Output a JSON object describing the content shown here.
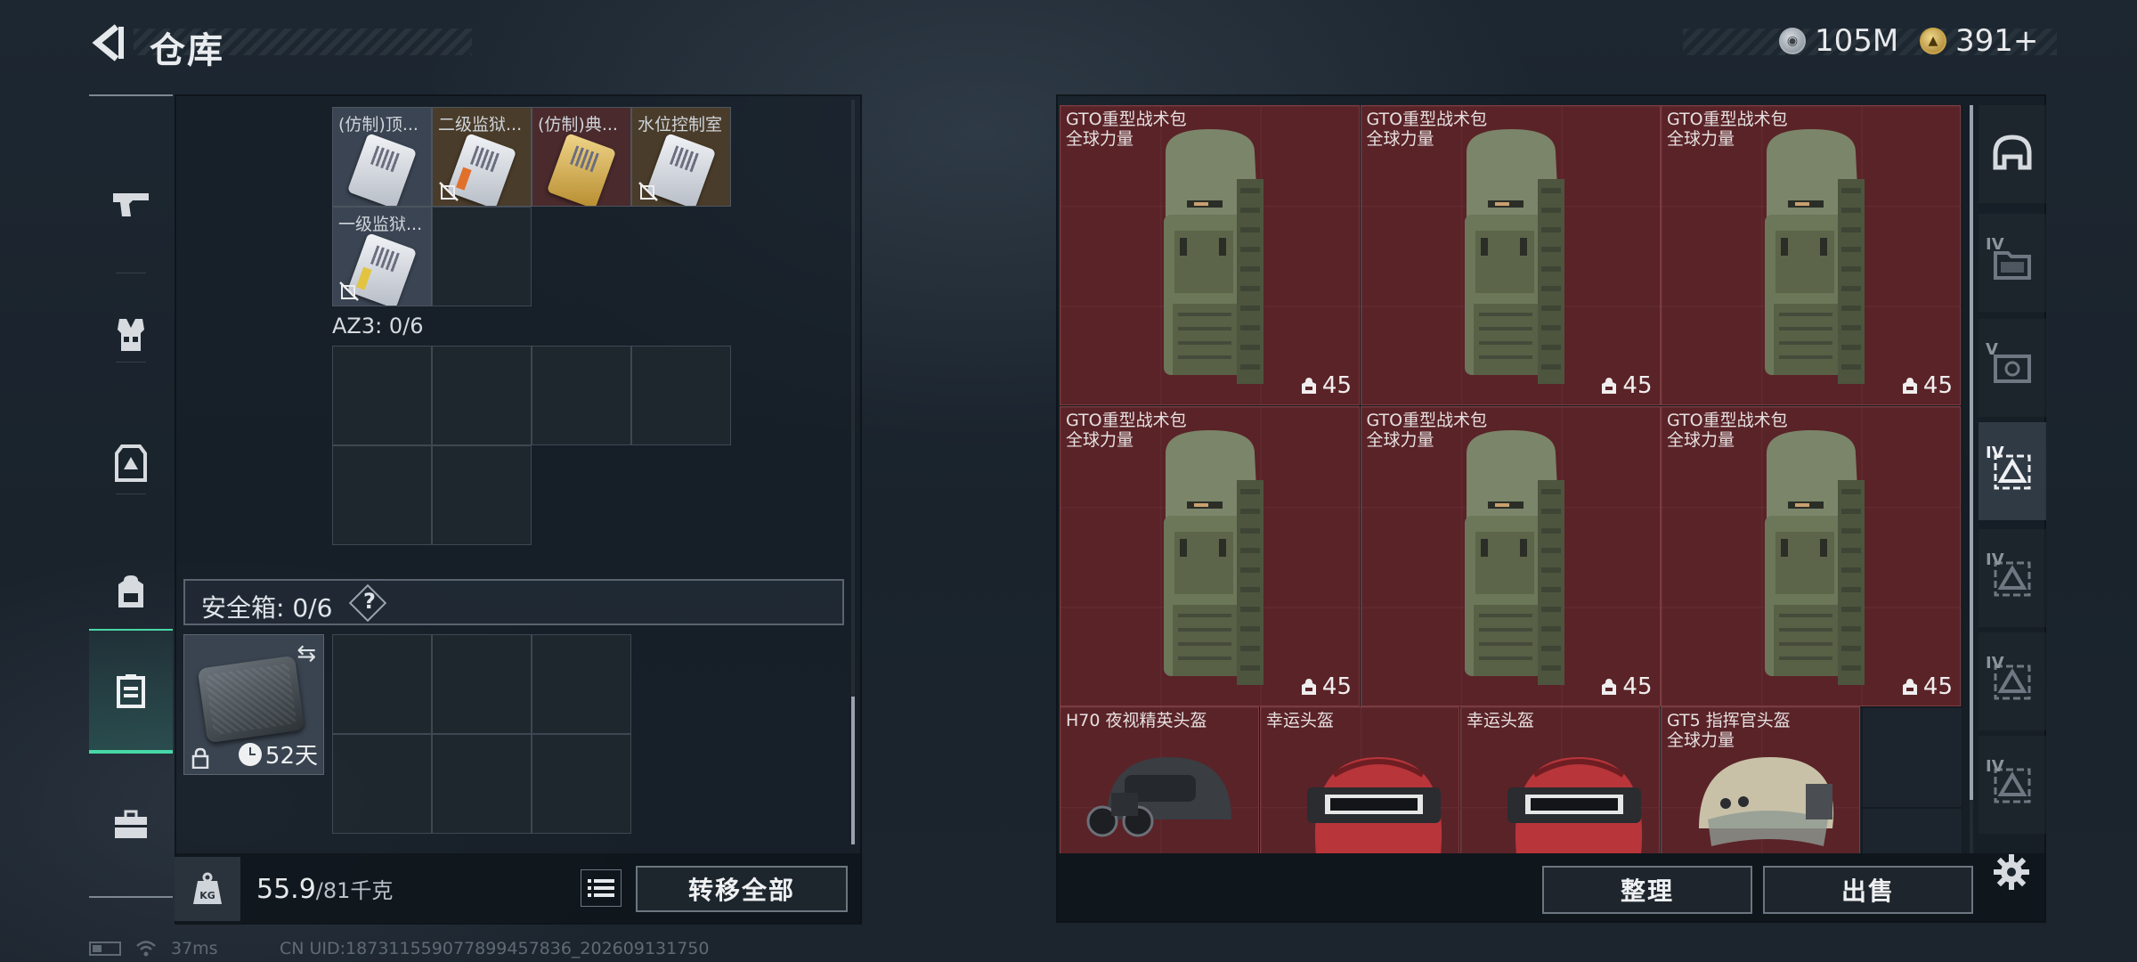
{
  "header": {
    "title": "仓库",
    "currencies": [
      {
        "icon": "silver-coin-icon",
        "value": "105M"
      },
      {
        "icon": "gold-coin-icon",
        "value": "391+"
      }
    ]
  },
  "left_nav": [
    {
      "icon": "pistol-icon"
    },
    {
      "icon": "vest-icon"
    },
    {
      "icon": "armor-icon"
    },
    {
      "icon": "backpack-icon"
    },
    {
      "icon": "safebox-icon",
      "active": true
    },
    {
      "icon": "toolbox-icon"
    }
  ],
  "keycards": [
    {
      "label": "(仿制)顶...",
      "style": "gray",
      "variant": "plain",
      "no_discard": false
    },
    {
      "label": "二级监狱...",
      "style": "gold",
      "variant": "orange",
      "no_discard": true
    },
    {
      "label": "(仿制)典...",
      "style": "red",
      "variant": "gold",
      "no_discard": false
    },
    {
      "label": "水位控制室",
      "style": "gold",
      "variant": "plain",
      "no_discard": true
    },
    {
      "label": "一级监狱...",
      "style": "gray",
      "variant": "yellow",
      "no_discard": true
    }
  ],
  "az3": {
    "label": "AZ3: 0/6"
  },
  "safebox": {
    "label": "安全箱:  0/6",
    "help": "?",
    "days": "52天"
  },
  "footer_left": {
    "weight_current": "55.9",
    "weight_max": "/81千克",
    "transfer_all": "转移全部"
  },
  "stash_items": {
    "backpacks": [
      {
        "name": "GTO重型战术包",
        "sub": "全球力量",
        "capacity": "45"
      },
      {
        "name": "GTO重型战术包",
        "sub": "全球力量",
        "capacity": "45"
      },
      {
        "name": "GTO重型战术包",
        "sub": "全球力量",
        "capacity": "45"
      },
      {
        "name": "GTO重型战术包",
        "sub": "全球力量",
        "capacity": "45"
      },
      {
        "name": "GTO重型战术包",
        "sub": "全球力量",
        "capacity": "45"
      },
      {
        "name": "GTO重型战术包",
        "sub": "全球力量",
        "capacity": "45"
      }
    ],
    "helmets": [
      {
        "name": "H70 夜视精英头盔",
        "sub": "",
        "type": "nv"
      },
      {
        "name": "幸运头盔",
        "sub": "",
        "type": "red"
      },
      {
        "name": "幸运头盔",
        "sub": "",
        "type": "red"
      },
      {
        "name": "GT5 指挥官头盔",
        "sub": "全球力量",
        "type": "tan"
      }
    ]
  },
  "footer_right": {
    "sort": "整理",
    "sell": "出售"
  },
  "right_nav": [
    {
      "icon": "helmet-tab-icon",
      "tier": ""
    },
    {
      "icon": "folder-tier4-icon",
      "tier": "IV"
    },
    {
      "icon": "keycard-tier5-icon",
      "tier": "V"
    },
    {
      "icon": "triangle-tier4-icon",
      "tier": "IV",
      "active": true
    },
    {
      "icon": "triangle-tier4b-icon",
      "tier": "IV"
    },
    {
      "icon": "triangle-tier4c-icon",
      "tier": "IV"
    },
    {
      "icon": "triangle-tier4d-icon",
      "tier": "IV"
    }
  ],
  "status": {
    "ping": "37ms",
    "uid": "CN UID:187311559077899457836_202609131750"
  }
}
